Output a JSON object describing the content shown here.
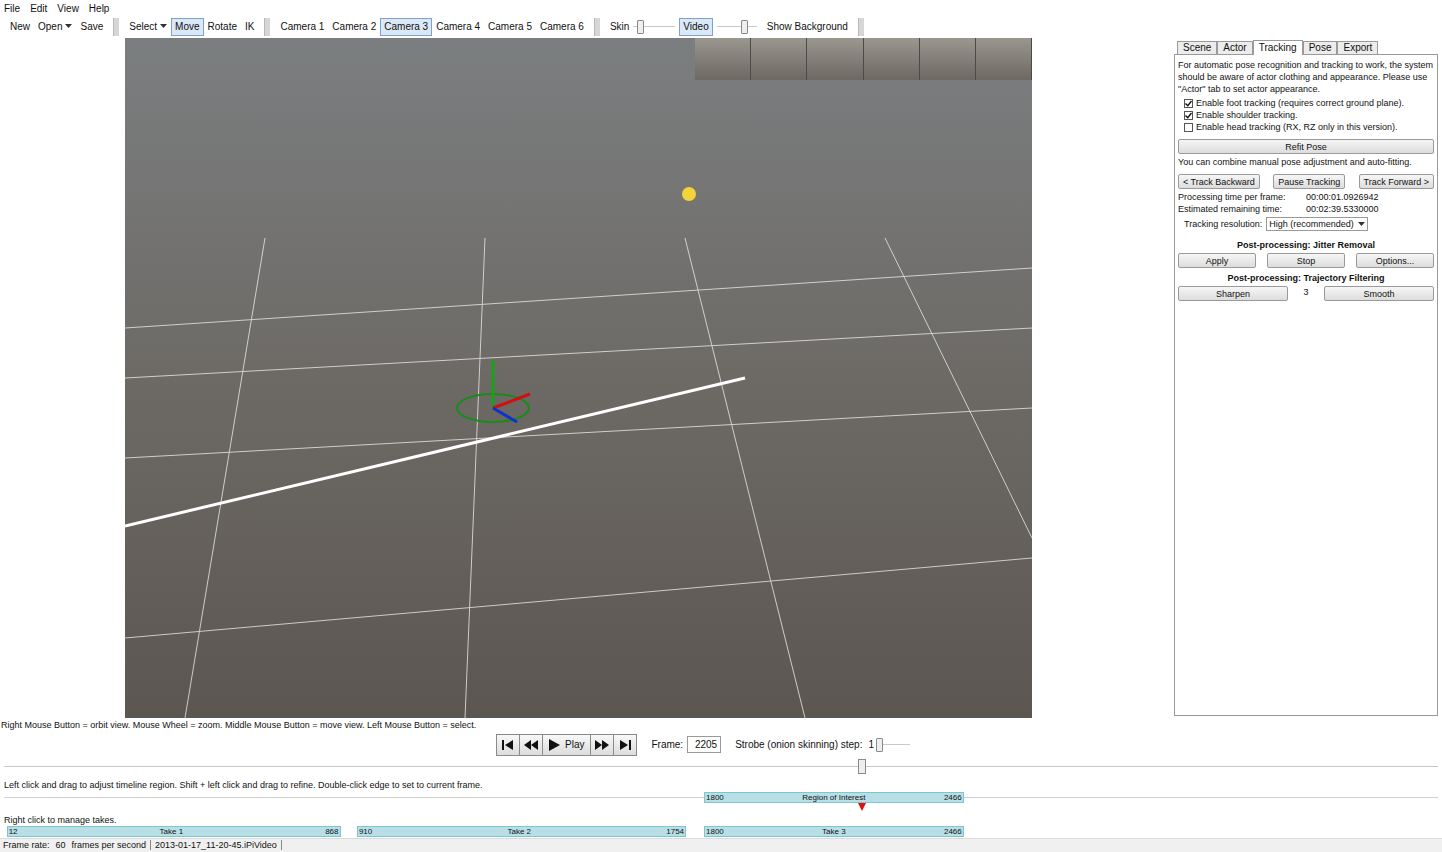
{
  "menu": [
    "File",
    "Edit",
    "View",
    "Help"
  ],
  "toolbar": {
    "file": [
      {
        "label": "New",
        "dropdown": false
      },
      {
        "label": "Open",
        "dropdown": true
      },
      {
        "label": "Save",
        "dropdown": false
      }
    ],
    "tools": [
      {
        "label": "Select",
        "dropdown": true,
        "selected": false
      },
      {
        "label": "Move",
        "dropdown": false,
        "selected": true
      },
      {
        "label": "Rotate",
        "dropdown": false,
        "selected": false
      },
      {
        "label": "IK",
        "dropdown": false,
        "selected": false
      }
    ],
    "cameras": [
      {
        "label": "Camera 1",
        "selected": false
      },
      {
        "label": "Camera 2",
        "selected": false
      },
      {
        "label": "Camera 3",
        "selected": true
      },
      {
        "label": "Camera 4",
        "selected": false
      },
      {
        "label": "Camera 5",
        "selected": false
      },
      {
        "label": "Camera 6",
        "selected": false
      }
    ],
    "skin": {
      "label": "Skin",
      "selected": false,
      "level": 0.15
    },
    "video": {
      "label": "Video",
      "selected": true,
      "level": 0.68
    },
    "show_background": {
      "label": "Show Background",
      "selected": false
    }
  },
  "right_panel": {
    "tabs": [
      {
        "label": "Scene",
        "selected": false
      },
      {
        "label": "Actor",
        "selected": false
      },
      {
        "label": "Tracking",
        "selected": true
      },
      {
        "label": "Pose",
        "selected": false
      },
      {
        "label": "Export",
        "selected": false
      }
    ],
    "intro": "For automatic pose recognition and tracking to work, the system should be aware of actor clothing and appearance. Please use \"Actor\" tab to set actor appearance.",
    "checkboxes": [
      {
        "label": "Enable foot tracking (requires correct ground plane).",
        "checked": true
      },
      {
        "label": "Enable shoulder tracking.",
        "checked": true
      },
      {
        "label": "Enable head tracking (RX, RZ only in this version).",
        "checked": false
      }
    ],
    "refit_button": "Refit Pose",
    "refit_hint": "You can combine manual pose adjustment and auto-fitting.",
    "track_buttons": [
      "< Track Backward",
      "Pause Tracking",
      "Track Forward >"
    ],
    "stats": [
      {
        "label": "Processing time per frame:",
        "value": "00:00:01.0926942"
      },
      {
        "label": "Estimated remaining time:",
        "value": "00:02:39.5330000"
      }
    ],
    "resolution": {
      "label": "Tracking resolution:",
      "value": "High (recommended)"
    },
    "jitter": {
      "title": "Post-processing: Jitter Removal",
      "buttons": [
        "Apply",
        "Stop",
        "Options..."
      ]
    },
    "trajectory": {
      "title": "Post-processing: Trajectory Filtering",
      "left": "Sharpen",
      "value": "3",
      "right": "Smooth"
    }
  },
  "view_hint": "Right Mouse Button = orbit view. Mouse Wheel = zoom. Middle Mouse Button = move view. Left Mouse Button = select.",
  "playback": {
    "buttons": [
      {
        "kind": "first",
        "label": ""
      },
      {
        "kind": "prev",
        "label": ""
      },
      {
        "kind": "play",
        "label": "Play"
      },
      {
        "kind": "next",
        "label": ""
      },
      {
        "kind": "last",
        "label": ""
      }
    ],
    "frame_label": "Frame:",
    "frame": "2205",
    "strobe_label": "Strobe (onion skinning) step:",
    "strobe_value": "1",
    "strobe_level": 0.1
  },
  "timeline_hint": "Left click and drag to adjust timeline region. Shift + left click and drag to refine. Double-click edge to set to current frame.",
  "region": {
    "start": "1800",
    "label": "Region of Interest",
    "end": "2466"
  },
  "takes_hint": "Right click to manage takes.",
  "takes": [
    {
      "label": "Take 1",
      "start": "12",
      "end": "868"
    },
    {
      "label": "Take 2",
      "start": "910",
      "end": "1754"
    },
    {
      "label": "Take 3",
      "start": "1800",
      "end": "2466"
    }
  ],
  "status_bar": {
    "frame_rate_label": "Frame rate:",
    "frame_rate": "60",
    "unit": "frames per second",
    "file": "2013-01-17_11-20-45.iPiVideo"
  }
}
